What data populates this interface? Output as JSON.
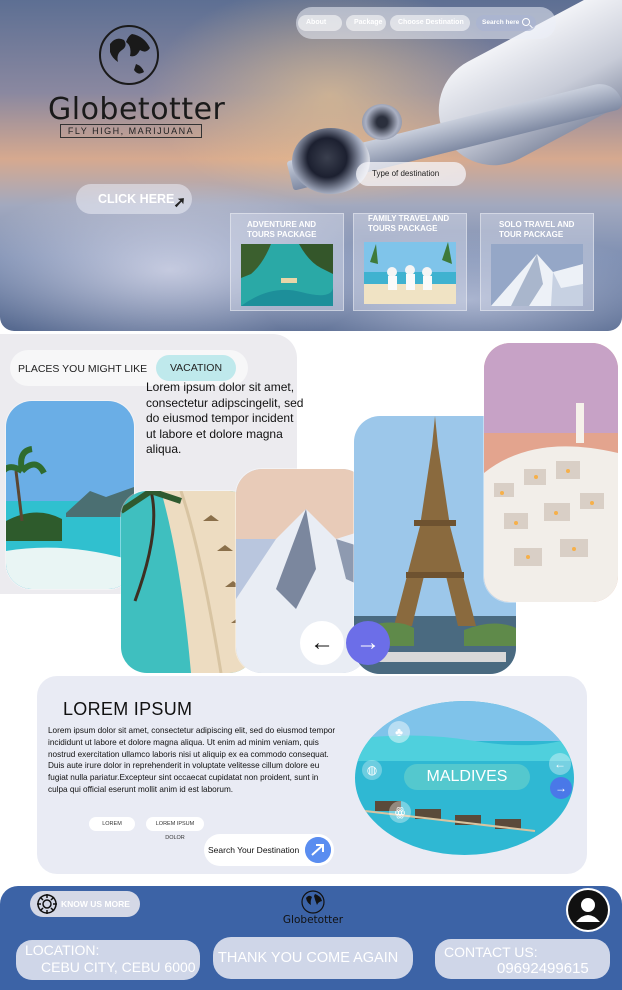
{
  "hero": {
    "brand": "Globetotter",
    "tagline": "FLY HIGH, MARIJUANA",
    "nav": {
      "about": "About",
      "package": "Package",
      "choose_destination": "Choose Destination",
      "search": "Search here"
    },
    "cta": "CLICK HERE",
    "type_placeholder": "Type of destination",
    "packages": [
      {
        "title": "ADVENTURE AND TOURS PACKAGE"
      },
      {
        "title": "FAMILY TRAVEL AND TOURS PACKAGE"
      },
      {
        "title": "SOLO TRAVEL AND TOUR PACKAGE"
      }
    ]
  },
  "places": {
    "title": "PLACES YOU MIGHT LIKE",
    "tag": "VACATION",
    "text": "Lorem ipsum dolor sit amet, consectetur adipscingelit, sed do eiusmod tempor incident ut labore et dolore magna aliqua."
  },
  "lorem": {
    "heading": "LOREM IPSUM",
    "body": "Lorem ipsum dolor sit amet, consectetur adipiscing elit, sed do eiusmod tempor incididunt ut labore et dolore magna aliqua. Ut enim ad minim veniam, quis nostrud exercitation ullamco laboris nisi ut aliquip ex ea commodo consequat. Duis aute irure dolor in reprehenderit in voluptate velitesse cillum dolore eu fugiat nulla pariatur.Excepteur sint occaecat cupidatat non proident, sunt in culpa qui official eserunt mollit anim id est laborum.",
    "pill1": "LOREM",
    "pill2": "LOREM IPSUM DOLOR",
    "search_label": "Search Your Destination",
    "feature": "MALDIVES"
  },
  "footer": {
    "know_more": "KNOW US MORE",
    "brand": "Globetotter",
    "location_label": "LOCATION:",
    "location_value": "CEBU CITY, CEBU 6000",
    "thanks": "THANK YOU COME AGAIN",
    "contact_label": "CONTACT US:",
    "contact_value": "09692499615"
  },
  "colors": {
    "footer_blue": "#3c63a6",
    "vacation_tag": "#bfe9ec",
    "arrow_purple": "#6c6ee8"
  }
}
